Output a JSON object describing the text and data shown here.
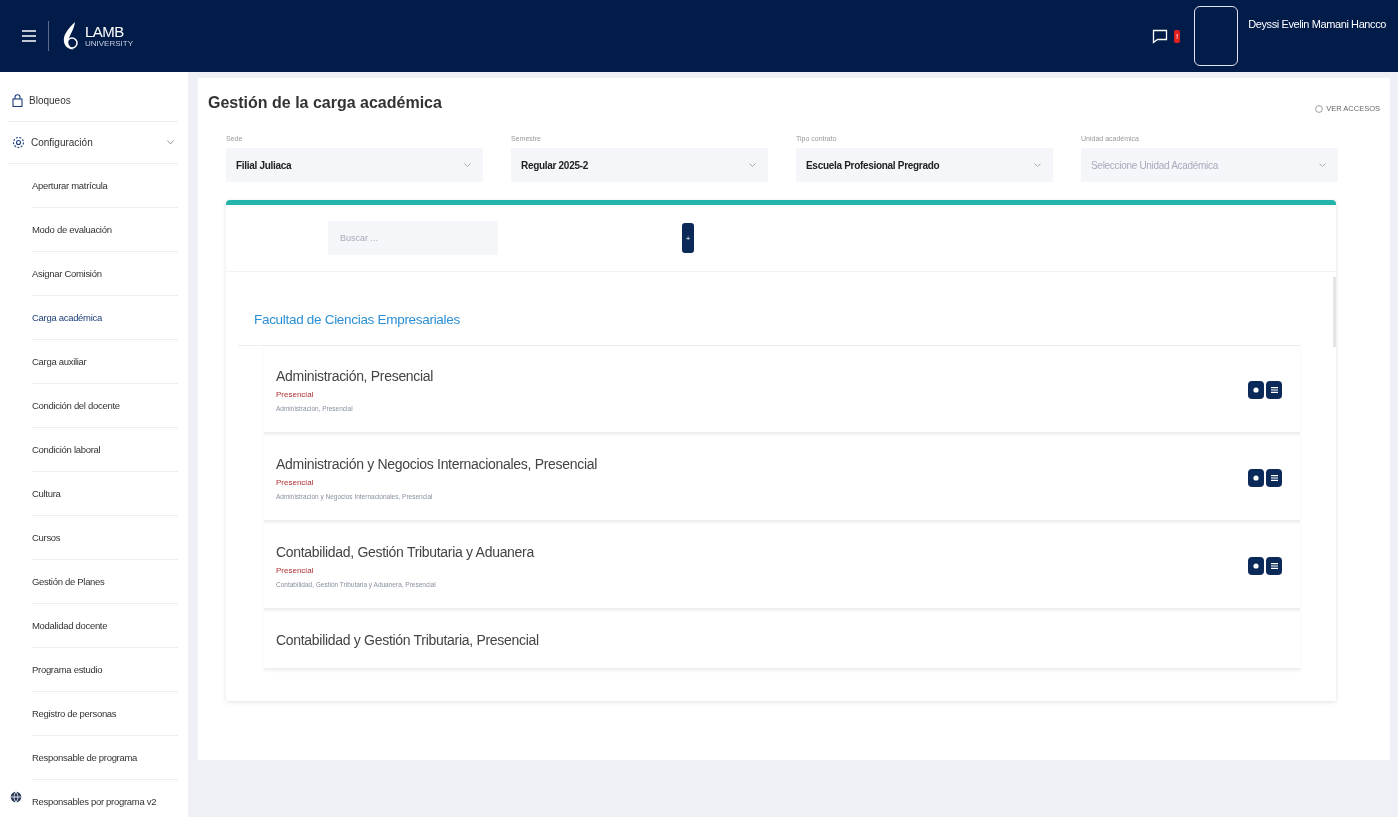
{
  "header": {
    "logo": {
      "name": "LAMB",
      "sub": "UNIVERSITY"
    },
    "notification_badge": "!",
    "user": {
      "name": "Deyssi Evelin Mamani Hancco"
    }
  },
  "sidebar": {
    "items": [
      {
        "label": "Bloqueos",
        "kind": "lock"
      },
      {
        "label": "Configuración",
        "kind": "gear",
        "expanded": true,
        "children": [
          {
            "label": "Aperturar matrícula",
            "selected": false
          },
          {
            "label": "Modo de evaluación",
            "selected": false
          },
          {
            "label": "Asignar Comisión",
            "selected": false
          },
          {
            "label": "Carga académica",
            "selected": true
          },
          {
            "label": "Carga auxiliar",
            "selected": false
          },
          {
            "label": "Condición del docente",
            "selected": false
          },
          {
            "label": "Condición laboral",
            "selected": false
          },
          {
            "label": "Cultura",
            "selected": false
          },
          {
            "label": "Cursos",
            "selected": false
          },
          {
            "label": "Gestión de Planes",
            "selected": false
          },
          {
            "label": "Modalidad docente",
            "selected": false
          },
          {
            "label": "Programa estudio",
            "selected": false
          },
          {
            "label": "Registro de personas",
            "selected": false
          },
          {
            "label": "Responsable de programa",
            "selected": false
          },
          {
            "label": "Responsables por programa v2",
            "selected": false
          }
        ]
      }
    ]
  },
  "page": {
    "title": "Gestión de la carga académica",
    "access_link": "VER ACCESOS",
    "filters": [
      {
        "label": "Sede",
        "value": "Filial Juliaca"
      },
      {
        "label": "Semestre",
        "value": "Regular 2025-2"
      },
      {
        "label": "Tipo contrato",
        "value": "Escuela Profesional Pregrado"
      },
      {
        "label": "Unidad académica",
        "placeholder": "Seleccione Unidad Académica"
      }
    ],
    "search": {
      "placeholder": "Buscar ..."
    },
    "add_button": "+",
    "faculty": "Facultad de Ciencias Empresariales",
    "programs": [
      {
        "title": "Administración, Presencial",
        "modality": "Presencial",
        "detail": "Administración, Presencial"
      },
      {
        "title": "Administración y Negocios Internacionales, Presencial",
        "modality": "Presencial",
        "detail": "Administración y Negocios Internacionales, Presencial"
      },
      {
        "title": "Contabilidad, Gestión Tributaria y Aduanera",
        "modality": "Presencial",
        "detail": "Contabilidad, Gestión Tributaria y Aduanera, Presencial"
      },
      {
        "title": "Contabilidad y Gestión Tributaria, Presencial"
      }
    ]
  }
}
